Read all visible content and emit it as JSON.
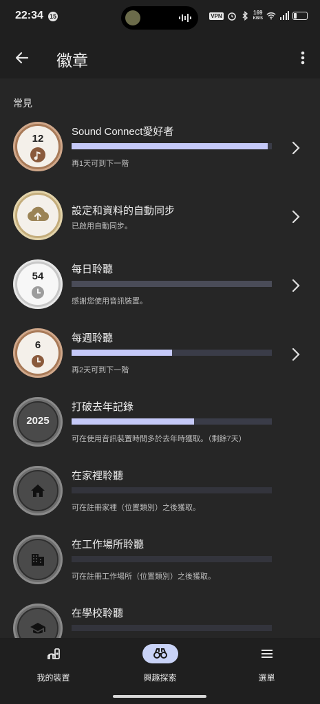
{
  "status": {
    "time": "22:34",
    "notification_count": "15",
    "vpn": "VPN",
    "net_speed_top": "169",
    "net_speed_unit": "KB/S",
    "signal": "4G"
  },
  "app_bar": {
    "title": "徽章"
  },
  "section": {
    "title": "常見"
  },
  "badges": [
    {
      "title": "Sound Connect愛好者",
      "subtitle": "再1天可到下一階",
      "medal_number": "12",
      "progress": 0.98,
      "medal": "bronze",
      "icon": "music-note-icon"
    },
    {
      "title": "設定和資料的自動同步",
      "subtitle": "已啟用自動同步。",
      "medal_number": "",
      "progress": null,
      "medal": "gold",
      "icon": "cloud-upload-icon"
    },
    {
      "title": "每日聆聽",
      "subtitle": "感謝您使用音訊裝置。",
      "medal_number": "54",
      "progress": 0.0,
      "medal": "silver",
      "icon": "clock-icon"
    },
    {
      "title": "每週聆聽",
      "subtitle": "再2天可到下一階",
      "medal_number": "6",
      "progress": 0.5,
      "medal": "bronze",
      "icon": "clock-icon"
    },
    {
      "title": "打破去年記錄",
      "subtitle": "可在使用音訊裝置時間多於去年時獲取。（剩餘7天）",
      "medal_number": "2025",
      "progress": 0.61,
      "medal": "locked",
      "icon": ""
    },
    {
      "title": "在家裡聆聽",
      "subtitle": "可在註冊家裡（位置類別）之後獲取。",
      "medal_number": "",
      "progress": 0.0,
      "medal": "locked",
      "icon": "home-icon"
    },
    {
      "title": "在工作場所聆聽",
      "subtitle": "可在註冊工作場所（位置類別）之後獲取。",
      "medal_number": "",
      "progress": 0.0,
      "medal": "locked",
      "icon": "building-icon"
    },
    {
      "title": "在學校聆聽",
      "subtitle": "",
      "medal_number": "",
      "progress": 0.0,
      "medal": "locked",
      "icon": "graduation-cap-icon"
    }
  ],
  "bottom_nav": {
    "items": [
      {
        "label": "我的裝置",
        "icon": "devices-icon"
      },
      {
        "label": "興趣探索",
        "icon": "binoculars-icon",
        "active": true
      },
      {
        "label": "選單",
        "icon": "menu-icon"
      }
    ]
  },
  "colors": {
    "progress_fill": "#c5c9f8",
    "progress_track": "#3a3c48",
    "bronze": "#a87a58",
    "gold": "#c4ad7c",
    "silver": "#c8c8c8",
    "locked": "#6e6e6e",
    "nav_active": "#c9d3f7"
  }
}
